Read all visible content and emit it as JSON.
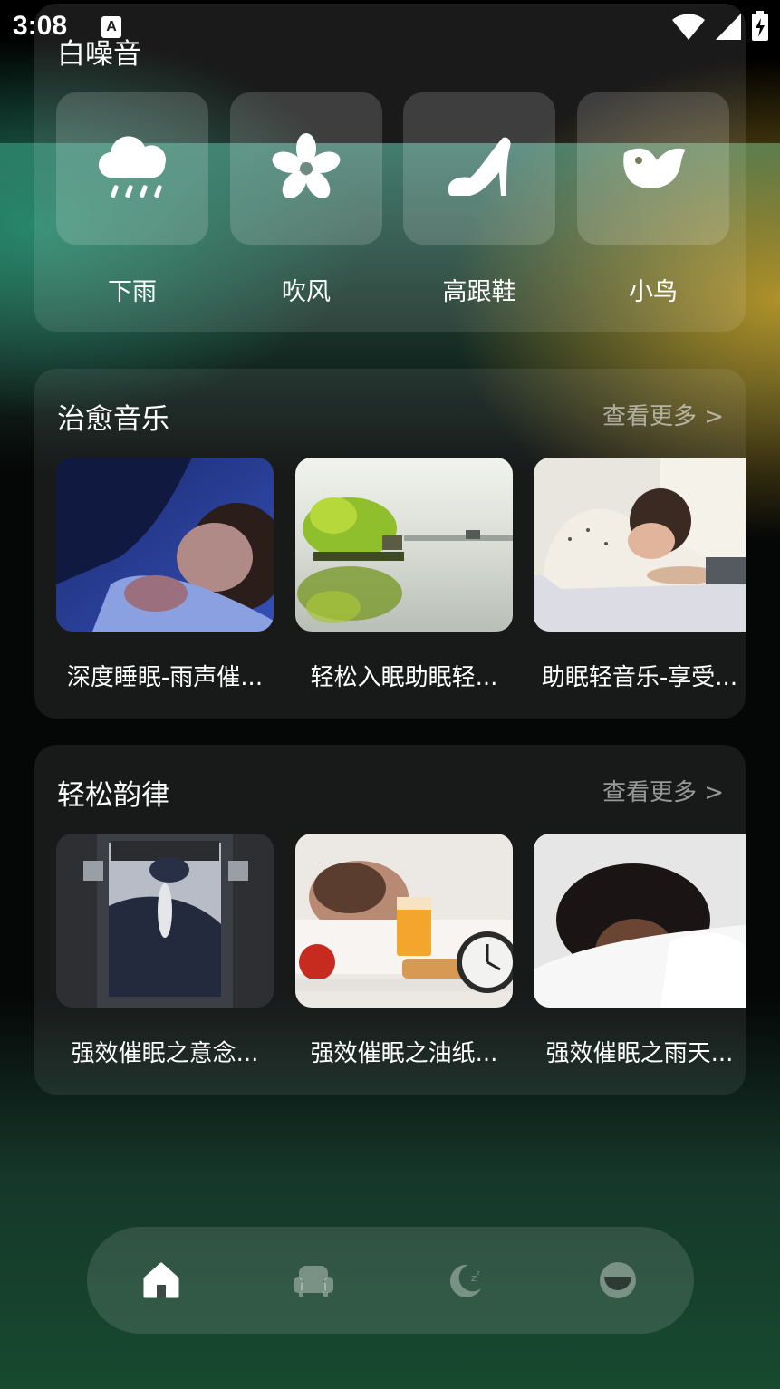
{
  "status_bar": {
    "time": "3:08",
    "notification_icon": "A"
  },
  "white_noise": {
    "title": "白噪音",
    "items": [
      {
        "label": "下雨",
        "icon": "rain-cloud-icon"
      },
      {
        "label": "吹风",
        "icon": "fan-icon"
      },
      {
        "label": "高跟鞋",
        "icon": "high-heel-icon"
      },
      {
        "label": "小鸟",
        "icon": "bird-icon"
      }
    ]
  },
  "healing_music": {
    "title": "治愈音乐",
    "more": "查看更多 >",
    "items": [
      {
        "label": "深度睡眠-雨声催..."
      },
      {
        "label": "轻松入眠助眠轻..."
      },
      {
        "label": "助眠轻音乐-享受..."
      }
    ]
  },
  "relaxing_rhythm": {
    "title": "轻松韵律",
    "more": "查看更多 >",
    "items": [
      {
        "label": "强效催眠之意念..."
      },
      {
        "label": "强效催眠之油纸..."
      },
      {
        "label": "强效催眠之雨天..."
      }
    ]
  },
  "tab_bar": {
    "tabs": [
      {
        "icon": "home-icon",
        "active": true
      },
      {
        "icon": "sofa-icon",
        "active": false
      },
      {
        "icon": "moon-sleep-icon",
        "active": false
      },
      {
        "icon": "mask-face-icon",
        "active": false
      }
    ]
  }
}
